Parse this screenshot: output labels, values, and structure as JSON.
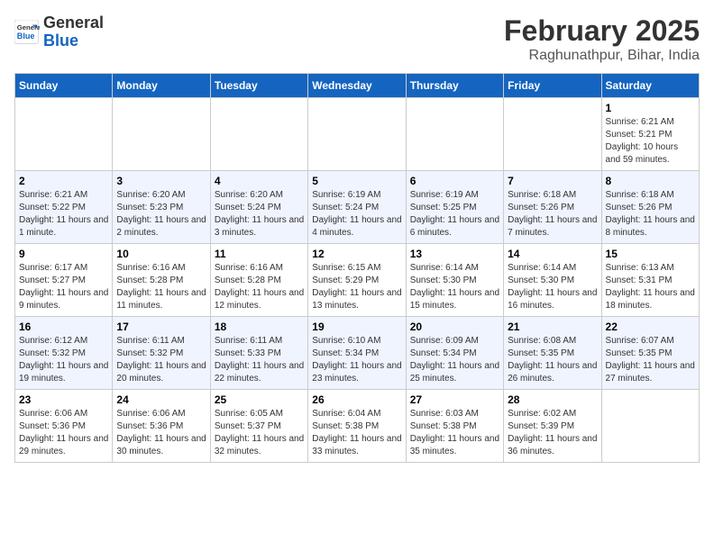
{
  "header": {
    "logo_line1": "General",
    "logo_line2": "Blue",
    "month_title": "February 2025",
    "location": "Raghunathpur, Bihar, India"
  },
  "weekdays": [
    "Sunday",
    "Monday",
    "Tuesday",
    "Wednesday",
    "Thursday",
    "Friday",
    "Saturday"
  ],
  "weeks": [
    [
      {
        "day": "",
        "info": ""
      },
      {
        "day": "",
        "info": ""
      },
      {
        "day": "",
        "info": ""
      },
      {
        "day": "",
        "info": ""
      },
      {
        "day": "",
        "info": ""
      },
      {
        "day": "",
        "info": ""
      },
      {
        "day": "1",
        "info": "Sunrise: 6:21 AM\nSunset: 5:21 PM\nDaylight: 10 hours\nand 59 minutes."
      }
    ],
    [
      {
        "day": "2",
        "info": "Sunrise: 6:21 AM\nSunset: 5:22 PM\nDaylight: 11 hours\nand 1 minute."
      },
      {
        "day": "3",
        "info": "Sunrise: 6:20 AM\nSunset: 5:23 PM\nDaylight: 11 hours\nand 2 minutes."
      },
      {
        "day": "4",
        "info": "Sunrise: 6:20 AM\nSunset: 5:24 PM\nDaylight: 11 hours\nand 3 minutes."
      },
      {
        "day": "5",
        "info": "Sunrise: 6:19 AM\nSunset: 5:24 PM\nDaylight: 11 hours\nand 4 minutes."
      },
      {
        "day": "6",
        "info": "Sunrise: 6:19 AM\nSunset: 5:25 PM\nDaylight: 11 hours\nand 6 minutes."
      },
      {
        "day": "7",
        "info": "Sunrise: 6:18 AM\nSunset: 5:26 PM\nDaylight: 11 hours\nand 7 minutes."
      },
      {
        "day": "8",
        "info": "Sunrise: 6:18 AM\nSunset: 5:26 PM\nDaylight: 11 hours\nand 8 minutes."
      }
    ],
    [
      {
        "day": "9",
        "info": "Sunrise: 6:17 AM\nSunset: 5:27 PM\nDaylight: 11 hours\nand 9 minutes."
      },
      {
        "day": "10",
        "info": "Sunrise: 6:16 AM\nSunset: 5:28 PM\nDaylight: 11 hours\nand 11 minutes."
      },
      {
        "day": "11",
        "info": "Sunrise: 6:16 AM\nSunset: 5:28 PM\nDaylight: 11 hours\nand 12 minutes."
      },
      {
        "day": "12",
        "info": "Sunrise: 6:15 AM\nSunset: 5:29 PM\nDaylight: 11 hours\nand 13 minutes."
      },
      {
        "day": "13",
        "info": "Sunrise: 6:14 AM\nSunset: 5:30 PM\nDaylight: 11 hours\nand 15 minutes."
      },
      {
        "day": "14",
        "info": "Sunrise: 6:14 AM\nSunset: 5:30 PM\nDaylight: 11 hours\nand 16 minutes."
      },
      {
        "day": "15",
        "info": "Sunrise: 6:13 AM\nSunset: 5:31 PM\nDaylight: 11 hours\nand 18 minutes."
      }
    ],
    [
      {
        "day": "16",
        "info": "Sunrise: 6:12 AM\nSunset: 5:32 PM\nDaylight: 11 hours\nand 19 minutes."
      },
      {
        "day": "17",
        "info": "Sunrise: 6:11 AM\nSunset: 5:32 PM\nDaylight: 11 hours\nand 20 minutes."
      },
      {
        "day": "18",
        "info": "Sunrise: 6:11 AM\nSunset: 5:33 PM\nDaylight: 11 hours\nand 22 minutes."
      },
      {
        "day": "19",
        "info": "Sunrise: 6:10 AM\nSunset: 5:34 PM\nDaylight: 11 hours\nand 23 minutes."
      },
      {
        "day": "20",
        "info": "Sunrise: 6:09 AM\nSunset: 5:34 PM\nDaylight: 11 hours\nand 25 minutes."
      },
      {
        "day": "21",
        "info": "Sunrise: 6:08 AM\nSunset: 5:35 PM\nDaylight: 11 hours\nand 26 minutes."
      },
      {
        "day": "22",
        "info": "Sunrise: 6:07 AM\nSunset: 5:35 PM\nDaylight: 11 hours\nand 27 minutes."
      }
    ],
    [
      {
        "day": "23",
        "info": "Sunrise: 6:06 AM\nSunset: 5:36 PM\nDaylight: 11 hours\nand 29 minutes."
      },
      {
        "day": "24",
        "info": "Sunrise: 6:06 AM\nSunset: 5:36 PM\nDaylight: 11 hours\nand 30 minutes."
      },
      {
        "day": "25",
        "info": "Sunrise: 6:05 AM\nSunset: 5:37 PM\nDaylight: 11 hours\nand 32 minutes."
      },
      {
        "day": "26",
        "info": "Sunrise: 6:04 AM\nSunset: 5:38 PM\nDaylight: 11 hours\nand 33 minutes."
      },
      {
        "day": "27",
        "info": "Sunrise: 6:03 AM\nSunset: 5:38 PM\nDaylight: 11 hours\nand 35 minutes."
      },
      {
        "day": "28",
        "info": "Sunrise: 6:02 AM\nSunset: 5:39 PM\nDaylight: 11 hours\nand 36 minutes."
      },
      {
        "day": "",
        "info": ""
      }
    ]
  ]
}
